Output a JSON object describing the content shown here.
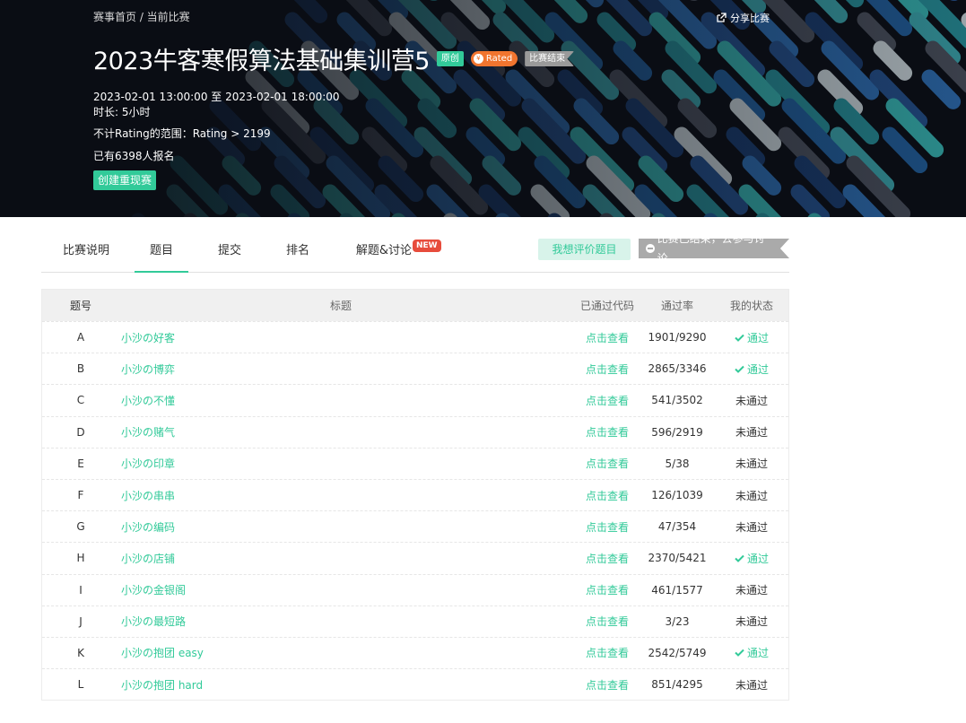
{
  "breadcrumb": "赛事首页 / 当前比赛",
  "share_label": "分享比赛",
  "contest": {
    "title": "2023牛客寒假算法基础集训营5",
    "badges": {
      "original": "原创",
      "rated": "Rated",
      "ended": "比赛结束"
    },
    "time_range": "2023-02-01 13:00:00 至 2023-02-01 18:00:00",
    "duration": "时长: 5小时",
    "rating_range": "不计Rating的范围：Rating > 2199",
    "registered": "已有6398人报名",
    "create_replay_label": "创建重现赛"
  },
  "tabs": [
    {
      "label": "比赛说明"
    },
    {
      "label": "题目"
    },
    {
      "label": "提交"
    },
    {
      "label": "排名"
    },
    {
      "label": "解题&讨论"
    }
  ],
  "new_badge": "NEW",
  "eval_button": "我想评价题目",
  "discuss_notice": "比赛已结束，去参与讨论",
  "table": {
    "headers": {
      "id": "题号",
      "title": "标题",
      "code": "已通过代码",
      "rate": "通过率",
      "status": "我的状态"
    },
    "view_code_label": "点击查看",
    "rows": [
      {
        "id": "A",
        "title": "小沙の好客",
        "rate": "1901/9290",
        "status": "通过",
        "passed": true
      },
      {
        "id": "B",
        "title": "小沙の博弈",
        "rate": "2865/3346",
        "status": "通过",
        "passed": true
      },
      {
        "id": "C",
        "title": "小沙の不懂",
        "rate": "541/3502",
        "status": "未通过",
        "passed": false
      },
      {
        "id": "D",
        "title": "小沙の赌气",
        "rate": "596/2919",
        "status": "未通过",
        "passed": false
      },
      {
        "id": "E",
        "title": "小沙の印章",
        "rate": "5/38",
        "status": "未通过",
        "passed": false
      },
      {
        "id": "F",
        "title": "小沙の串串",
        "rate": "126/1039",
        "status": "未通过",
        "passed": false
      },
      {
        "id": "G",
        "title": "小沙の编码",
        "rate": "47/354",
        "status": "未通过",
        "passed": false
      },
      {
        "id": "H",
        "title": "小沙の店铺",
        "rate": "2370/5421",
        "status": "通过",
        "passed": true
      },
      {
        "id": "I",
        "title": "小沙の金银阁",
        "rate": "461/1577",
        "status": "未通过",
        "passed": false
      },
      {
        "id": "J",
        "title": "小沙の最短路",
        "rate": "3/23",
        "status": "未通过",
        "passed": false
      },
      {
        "id": "K",
        "title": "小沙の抱团 easy",
        "rate": "2542/5749",
        "status": "通过",
        "passed": true
      },
      {
        "id": "L",
        "title": "小沙の抱团 hard",
        "rate": "851/4295",
        "status": "未通过",
        "passed": false
      }
    ]
  }
}
